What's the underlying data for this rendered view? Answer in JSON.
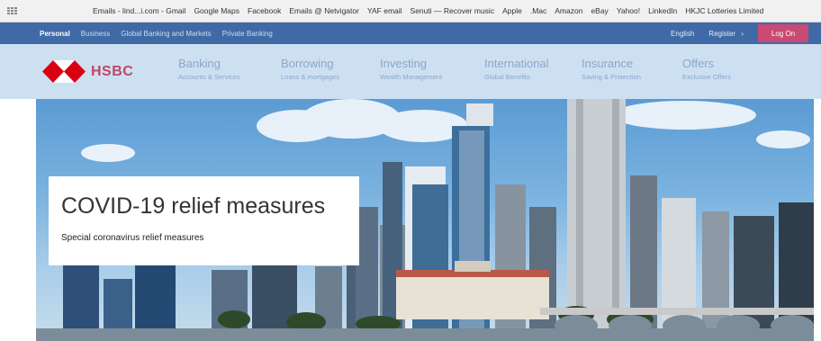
{
  "bookmarks": {
    "items": [
      "Emails - lind...i.com - Gmail",
      "Google Maps",
      "Facebook",
      "Emails @ Netvigator",
      "YAF email",
      "Senuti — Recover music",
      "Apple",
      ".Mac",
      "Amazon",
      "eBay",
      "Yahoo!",
      "LinkedIn",
      "HKJC Lotteries Limited"
    ]
  },
  "topnav": {
    "left": [
      "Personal",
      "Business",
      "Global Banking and Markets",
      "Private Banking"
    ],
    "language": "English",
    "register": "Register",
    "login": "Log On"
  },
  "logo": {
    "text": "HSBC"
  },
  "menu": [
    {
      "title": "Banking",
      "subtitle": "Accounts & Services"
    },
    {
      "title": "Borrowing",
      "subtitle": "Loans & mortgages"
    },
    {
      "title": "Investing",
      "subtitle": "Wealth Management"
    },
    {
      "title": "International",
      "subtitle": "Global Benefits"
    },
    {
      "title": "Insurance",
      "subtitle": "Saving & Protection"
    },
    {
      "title": "Offers",
      "subtitle": "Exclusive Offers"
    }
  ],
  "hero": {
    "title": "COVID-19 relief measures",
    "subtitle": "Special coronavirus relief measures"
  },
  "colors": {
    "brand_red": "#db0011",
    "login_bg": "#c94a73",
    "nav_blue": "#3f6aa5",
    "menu_bg": "#cde0f1"
  }
}
